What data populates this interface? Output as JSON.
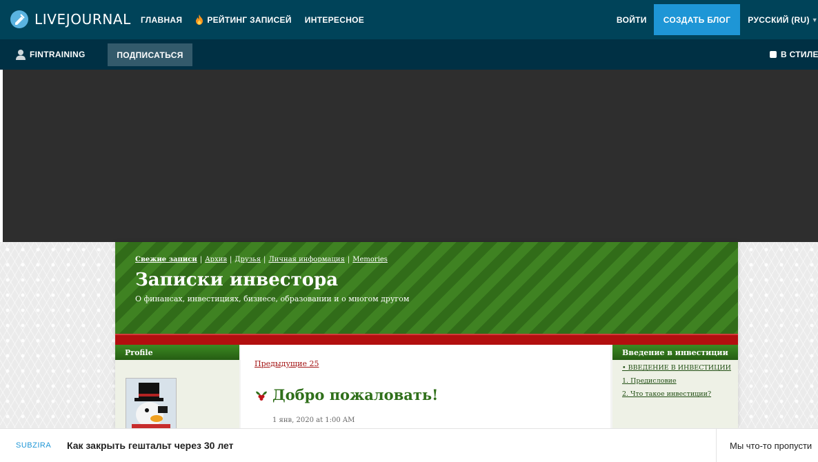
{
  "colors": {
    "topbar": "#004359",
    "subbar": "#003044",
    "accent": "#1e96d6",
    "blog_green": "#2f6f1a",
    "blog_red": "#b20f0f"
  },
  "topbar": {
    "logo_text": "LIVEJOURNAL",
    "logo_icon": "livejournal-pen-icon",
    "nav": [
      {
        "label": "ГЛАВНАЯ"
      },
      {
        "label": "РЕЙТИНГ ЗАПИСЕЙ",
        "icon": "flame-icon"
      },
      {
        "label": "ИНТЕРЕСНОЕ"
      }
    ],
    "login": "ВОЙТИ",
    "create_blog": "СОЗДАТЬ БЛОГ",
    "language": "РУССКИЙ (RU)"
  },
  "subbar": {
    "username": "FINTRAINING",
    "subscribe": "ПОДПИСАТЬСЯ",
    "style_toggle": "В СТИЛЕ"
  },
  "blog": {
    "nav": [
      "Свежие записи",
      "Архив",
      "Друзья",
      "Личная информация",
      "Memories"
    ],
    "title": "Записки инвестора",
    "subtitle": "О финансах, инвестициях, бизнесе, образовании и о многом другом",
    "left_head": "Profile",
    "prev_link": "Предыдущие 25",
    "post_title": "Добро пожаловать!",
    "post_date": "1 янв, 2020 at 1:00 AM",
    "right_head": "Введение в инвестиции",
    "right_links": [
      "• ВВЕДЕНИЕ В ИНВЕСТИЦИИ",
      "1. Предисловие",
      "2. Что такое инвестиции?"
    ]
  },
  "bottom": {
    "brand": "SUBZIRA",
    "headline": "Как закрыть гештальт через 30 лет",
    "right_text": "Мы что-то пропусти"
  }
}
